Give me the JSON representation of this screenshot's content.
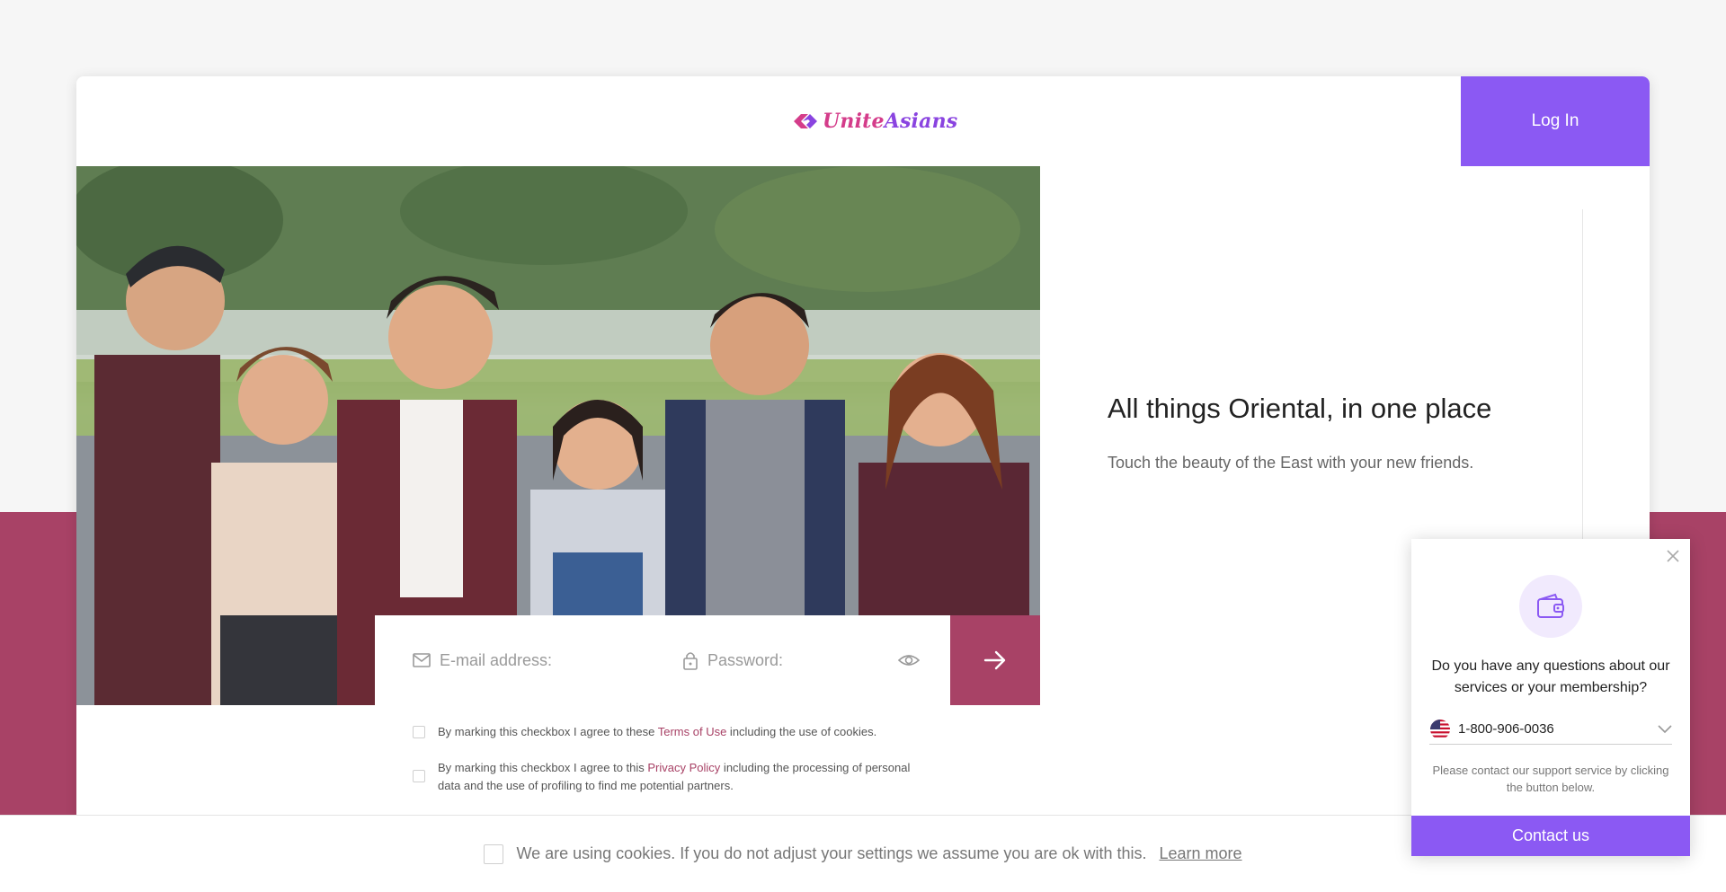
{
  "header": {
    "logo_text_a": "Unite",
    "logo_text_b": "Asians",
    "login_label": "Log In"
  },
  "hero": {
    "headline": "All things Oriental, in one place",
    "subline": "Touch the beauty of the East with your new friends."
  },
  "login_form": {
    "email_placeholder": "E-mail address:",
    "password_placeholder": "Password:",
    "icons": {
      "email": "mail-icon",
      "password": "lock-icon",
      "reveal": "eye-icon",
      "submit": "arrow-right-icon"
    }
  },
  "consents": [
    {
      "prefix": "By marking this checkbox I agree to these ",
      "link": "Terms of Use",
      "suffix": " including the use of cookies."
    },
    {
      "prefix": "By marking this checkbox I agree to this ",
      "link": "Privacy Policy",
      "suffix": " including the processing of personal data and the use of profiling to find me potential partners."
    }
  ],
  "cookie_bar": {
    "message": "We are using cookies. If you do not adjust your settings we assume you are ok with this.",
    "learn_more": "Learn more"
  },
  "support_widget": {
    "question": "Do you have any questions about our services or your membership?",
    "phone": "1-800-906-0036",
    "note": "Please contact our support service by clicking the button below.",
    "contact_label": "Contact us",
    "icons": {
      "close": "close-icon",
      "wallet": "wallet-icon",
      "flag": "us-flag-icon",
      "dropdown": "chevron-down-icon"
    }
  },
  "colors": {
    "purple": "#8b59f3",
    "brand_pink": "#a84266",
    "logo_pink": "#d43c8a",
    "logo_purple": "#8a44e0"
  }
}
